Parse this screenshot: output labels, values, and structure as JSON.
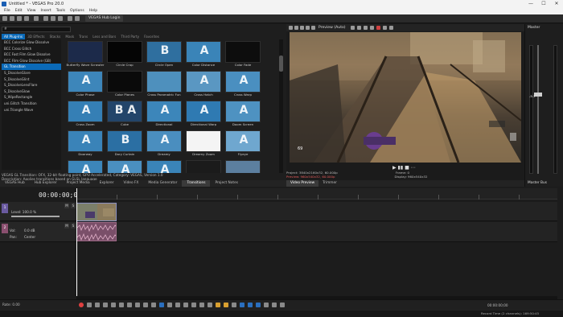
{
  "window": {
    "title": "Untitled * - VEGAS Pro 20.0",
    "minimize": "—",
    "maximize": "☐",
    "close": "✕"
  },
  "menu": [
    "File",
    "Edit",
    "View",
    "Insert",
    "Tools",
    "Options",
    "Help"
  ],
  "toolbar": {
    "hub_login": "VEGAS Hub Login"
  },
  "explorer": {
    "search_value": "#",
    "category_tabs": [
      "All Plug-Ins",
      "3D Effects",
      "Stacks",
      "Mask",
      "Trans",
      "Less and Bars",
      "Third Party",
      "Favorites"
    ],
    "active_category": 0,
    "tree": [
      "BCC Colorize Glow Dissolve",
      "BCC Cross Glitch",
      "BCC Fast Film Glow Dissolve",
      "BCC Film Glow Dissolve (GB)",
      "GL Transition",
      "S_DissolveGlare",
      "S_DissolveGlint",
      "S_DissolveLensFlare",
      "S_DissolveGlow",
      "S_WipeRectangle",
      "uni.Glitch Transition",
      "uni.Triangle Wave"
    ],
    "selected_tree": 4,
    "thumbnails": [
      {
        "label": "Butterfly Wave Scrawler",
        "glyph": "",
        "bg": "#1c2a4a"
      },
      {
        "label": "Circle Crop",
        "glyph": "",
        "bg": "#050505"
      },
      {
        "label": "Circle Open",
        "glyph": "B",
        "bg": "#2f6f9f"
      },
      {
        "label": "Color Distance",
        "glyph": "A",
        "bg": "#3a84b8"
      },
      {
        "label": "Color Fade",
        "glyph": "",
        "bg": "#0d0d0d"
      },
      {
        "label": "Color Phase",
        "glyph": "A",
        "bg": "#3d86ba"
      },
      {
        "label": "Color Planes",
        "glyph": "",
        "bg": "#0a0a0a"
      },
      {
        "label": "Cross Paramatric Fun",
        "glyph": "",
        "bg": "#4e90bd"
      },
      {
        "label": "Cross Hatch",
        "glyph": "A",
        "bg": "#5a97c2"
      },
      {
        "label": "Cross Warp",
        "glyph": "A",
        "bg": "#4a8fc0"
      },
      {
        "label": "Cross Zoom",
        "glyph": "A",
        "bg": "#357fb5"
      },
      {
        "label": "Cube",
        "glyph": "B A",
        "bg": "#23456a"
      },
      {
        "label": "Directional",
        "glyph": "A",
        "bg": "#3c86ba"
      },
      {
        "label": "Directional Warp",
        "glyph": "A",
        "bg": "#2f7ab2"
      },
      {
        "label": "Doom Screen",
        "glyph": "A",
        "bg": "#4e92c1"
      },
      {
        "label": "Doorway",
        "glyph": "A",
        "bg": "#3a83b8"
      },
      {
        "label": "Dory Curtain",
        "glyph": "B",
        "bg": "#2b6fa3"
      },
      {
        "label": "Dreamy",
        "glyph": "A",
        "bg": "#4a8ebf"
      },
      {
        "label": "Dreamy Zoom",
        "glyph": "",
        "bg": "#f4f4f4"
      },
      {
        "label": "Flyeye",
        "glyph": "A",
        "bg": "#6fa7cf"
      },
      {
        "label": "",
        "glyph": "A",
        "bg": "#3c86ba"
      },
      {
        "label": "",
        "glyph": "A",
        "bg": "#4a8fc0"
      },
      {
        "label": "",
        "glyph": "A",
        "bg": "#3a84b8"
      },
      {
        "label": "",
        "glyph": "",
        "bg": "#1b1b1b"
      },
      {
        "label": "",
        "glyph": "",
        "bg": "#5c7f9f"
      }
    ],
    "status_line1": "VEGAS GL Transition: OFX, 32-bit floating point, GPU Accelerated, Category: VEGAS, Version 1.0",
    "status_line2": "Description: Applies transitions based on GLSL language",
    "dock_tabs": [
      "VEGAS Hub",
      "Hub Explorer",
      "Project Media",
      "Explorer",
      "Video FX",
      "Media Generator",
      "Transitions",
      "Project Notes"
    ],
    "active_dock_tab": 6
  },
  "preview": {
    "label": "Preview (Auto)",
    "project": "Project:  3840x2160x32, 60.000p",
    "preview_res": "Preview:  960x540x32, 60.000p",
    "display": "Display:  960x540x32",
    "frame": "Frame:  0",
    "display_label": "Display:",
    "tabs": [
      "Video Preview",
      "Trimmer"
    ],
    "active_tab": 0,
    "controls": [
      "▶",
      "▮▮",
      "■",
      "⋯"
    ],
    "hud_number": "69"
  },
  "master": {
    "title": "Master",
    "db": "-5.3",
    "bus": "Master Bus"
  },
  "timeline": {
    "timecode": "00:00:00;00",
    "video_track": {
      "number": "1",
      "level_label": "Level: 100.0 %",
      "m": "M",
      "s": "S"
    },
    "audio_track": {
      "number": "2",
      "vol_label": "Vol:",
      "vol_value": "0.0 dB",
      "pan_label": "Pan:",
      "pan_value": "Center",
      "m": "M",
      "s": "S"
    },
    "rate": "Rate: 0.00",
    "time_display": "00:00:00;00",
    "record_time": "Record Time (2 channels): 169:50:45"
  },
  "colors": {
    "accent": "#0b6ab8",
    "video_clip": "#6b6ea0",
    "audio_clip": "#7a4f69",
    "record": "#e04040"
  }
}
